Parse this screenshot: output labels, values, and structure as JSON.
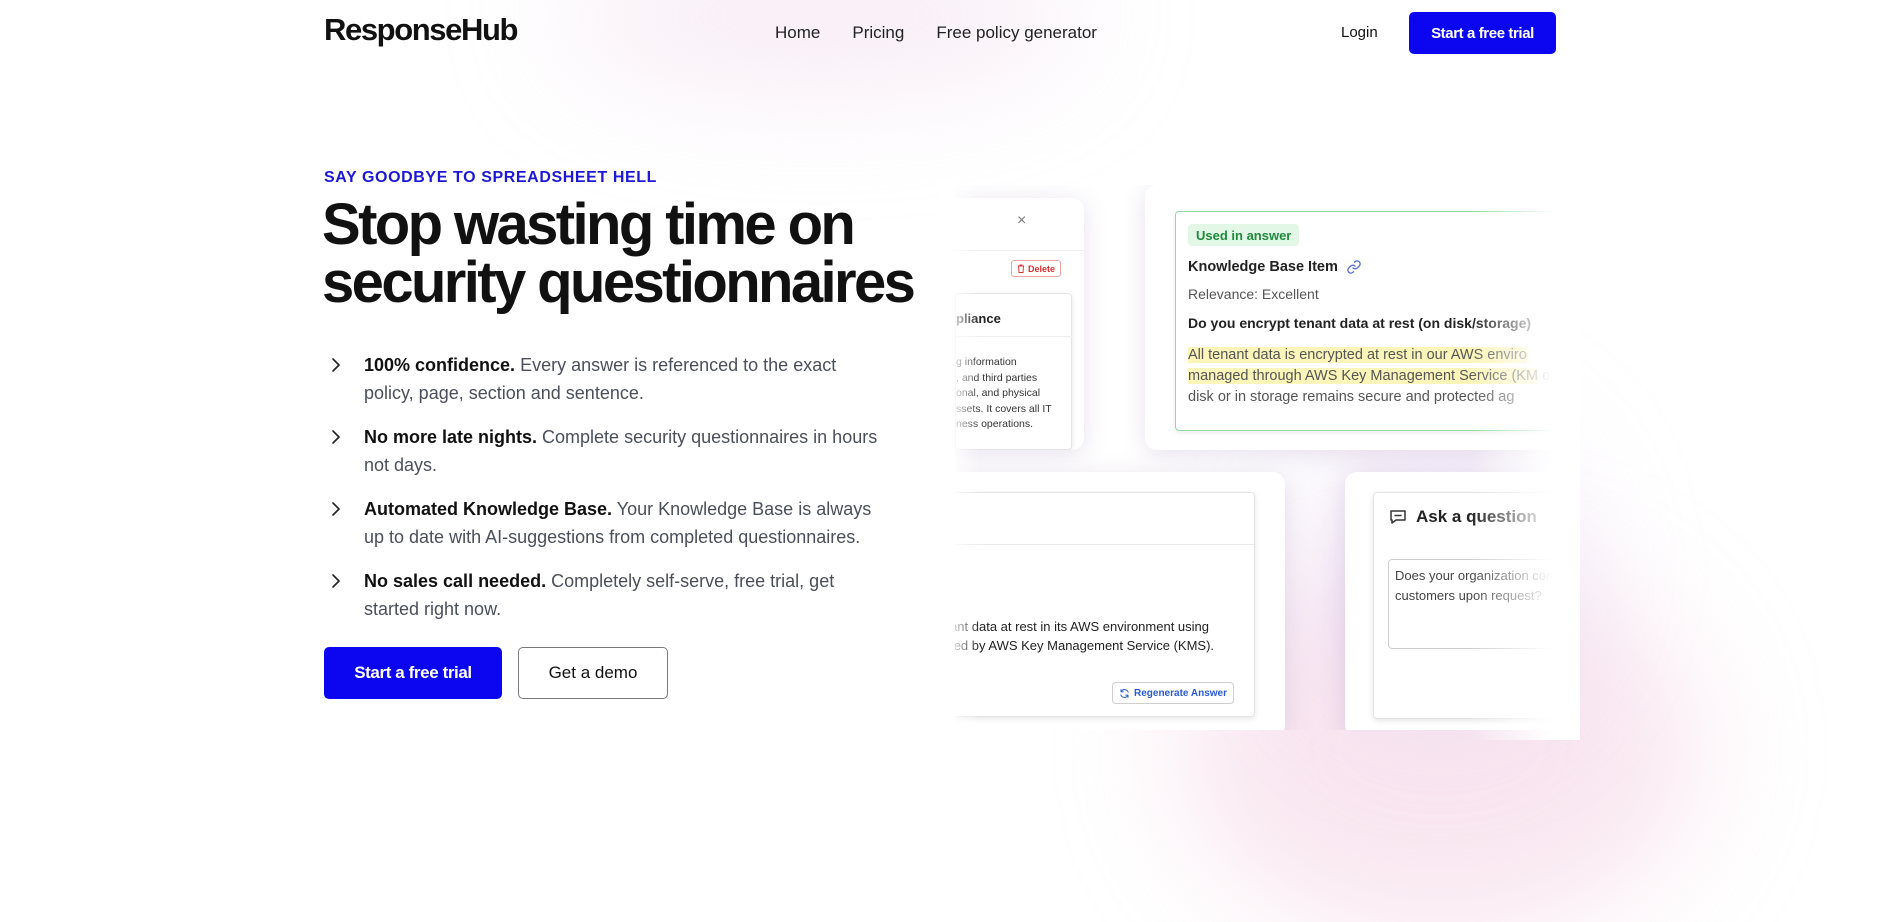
{
  "nav": {
    "logo": "ResponseHub",
    "links": [
      "Home",
      "Pricing",
      "Free policy generator"
    ],
    "login": "Login",
    "cta": "Start a free trial"
  },
  "hero": {
    "eyebrow": "SAY GOODBYE TO SPREADSHEET HELL",
    "headline": "Stop wasting time on security questionnaires",
    "features": [
      {
        "title": "100% confidence.",
        "text": " Every answer is referenced to the exact policy, page, section and sentence."
      },
      {
        "title": "No more late nights.",
        "text": " Complete security questionnaires in hours not days."
      },
      {
        "title": "Automated Knowledge Base.",
        "text": " Your Knowledge Base is always up to date with AI-suggestions from completed questionnaires."
      },
      {
        "title": "No sales call needed.",
        "text": " Completely self-serve, free trial, get started right now."
      }
    ],
    "primary_cta": "Start a free trial",
    "secondary_cta": "Get a demo"
  },
  "preview": {
    "policy_card": {
      "close": "×",
      "delete": "Delete",
      "section_title": "pliance",
      "body": "g information\n, and third parties\nonal, and physical\nssets. It covers all IT\nness operations."
    },
    "kb_card": {
      "badge": "Used in answer",
      "title": "Knowledge Base Item",
      "relevance": "Relevance: Excellent",
      "question": "Do you encrypt tenant data at rest (on disk/storage)",
      "answer_highlight": "All tenant data is encrypted at rest in our AWS enviro managed through AWS Key Management Service (KM",
      "answer_rest": " on disk or in storage remains secure and protected ag"
    },
    "answer_card": {
      "text": "tenant data at rest in its AWS environment using\nnaged by AWS Key Management Service (KMS).",
      "regenerate": "Regenerate Answer"
    },
    "ask_card": {
      "title": "Ask a question",
      "input": "Does your organization condu with customers upon request?"
    }
  },
  "colors": {
    "brand": "#0b05f0",
    "eyebrow": "#1d18d6",
    "highlight": "#fbf5b9",
    "badge_bg": "#e3f7e7",
    "badge_text": "#1e8a3c",
    "delete": "#d93030"
  }
}
